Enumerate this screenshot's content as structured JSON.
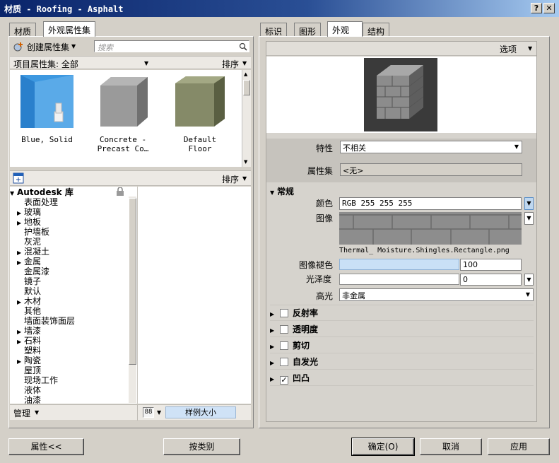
{
  "window": {
    "title": "材质 - Roofing - Asphalt",
    "help_btn": "?",
    "close_btn": "✕"
  },
  "left_tabs": [
    {
      "label": "材质"
    },
    {
      "label": "外观属性集"
    }
  ],
  "left_toolbar": {
    "create_label": "创建属性集",
    "search_placeholder": "搜索"
  },
  "project_assets": {
    "label": "项目属性集: 全部",
    "sort_label": "排序"
  },
  "thumbnails": [
    {
      "label1": "Blue, Solid",
      "label2": ""
    },
    {
      "label1": "Concrete -",
      "label2": "Precast Co…"
    },
    {
      "label1": "Default",
      "label2": "Floor"
    }
  ],
  "library": {
    "sort_label": "排序",
    "root": "Autodesk 库",
    "items": [
      {
        "label": "表面处理",
        "expandable": false
      },
      {
        "label": "玻璃",
        "expandable": true
      },
      {
        "label": "地板",
        "expandable": true
      },
      {
        "label": "护墙板",
        "expandable": false
      },
      {
        "label": "灰泥",
        "expandable": false
      },
      {
        "label": "混凝土",
        "expandable": true
      },
      {
        "label": "金属",
        "expandable": true
      },
      {
        "label": "金属漆",
        "expandable": false
      },
      {
        "label": "镜子",
        "expandable": false
      },
      {
        "label": "默认",
        "expandable": false
      },
      {
        "label": "木材",
        "expandable": true
      },
      {
        "label": "其他",
        "expandable": false
      },
      {
        "label": "墙面装饰面层",
        "expandable": false
      },
      {
        "label": "墙漆",
        "expandable": true
      },
      {
        "label": "石料",
        "expandable": true
      },
      {
        "label": "塑料",
        "expandable": false
      },
      {
        "label": "陶瓷",
        "expandable": true
      },
      {
        "label": "屋顶",
        "expandable": false
      },
      {
        "label": "现场工作",
        "expandable": false
      },
      {
        "label": "液体",
        "expandable": false
      },
      {
        "label": "油漆",
        "expandable": false
      }
    ],
    "manage_label": "管理",
    "size_label": "样例大小",
    "size_icon": "88"
  },
  "right_tabs": [
    {
      "label": "标识"
    },
    {
      "label": "图形"
    },
    {
      "label": "外观"
    },
    {
      "label": "结构"
    }
  ],
  "options_label": "选项",
  "properties": {
    "characteristic_label": "特性",
    "characteristic_value": "不相关",
    "asset_label": "属性集",
    "asset_value": "<无>"
  },
  "general": {
    "header": "常规",
    "color_label": "颜色",
    "color_value": "RGB 255 255 255",
    "image_label": "图像",
    "image_file": "Thermal_ Moisture.Shingles.Rectangle.png",
    "fade_label": "图像褪色",
    "fade_value": "100",
    "gloss_label": "光泽度",
    "gloss_value": "0",
    "highlight_label": "高光",
    "highlight_value": "非金属"
  },
  "categories": [
    {
      "label": "反射率",
      "checked": false
    },
    {
      "label": "透明度",
      "checked": false
    },
    {
      "label": "剪切",
      "checked": false
    },
    {
      "label": "自发光",
      "checked": false
    },
    {
      "label": "凹凸",
      "checked": true
    }
  ],
  "buttons": {
    "properties": "属性<<",
    "by_category": "按类别",
    "ok": "确定(O)",
    "cancel": "取消",
    "apply": "应用"
  }
}
